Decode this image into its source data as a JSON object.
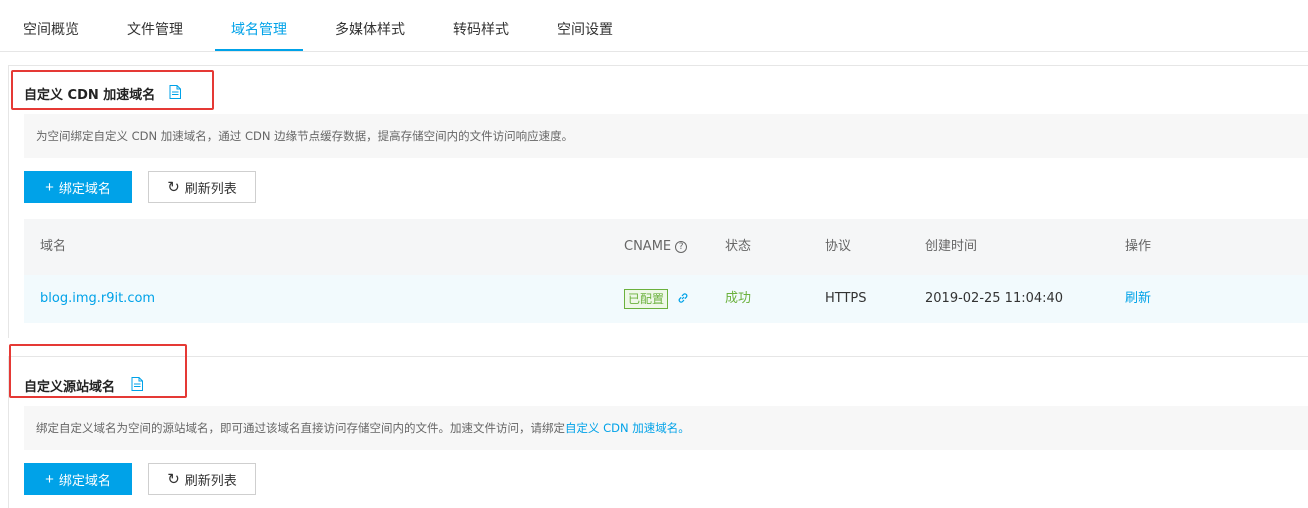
{
  "tabs": [
    {
      "label": "空间概览"
    },
    {
      "label": "文件管理"
    },
    {
      "label": "域名管理",
      "active": true
    },
    {
      "label": "多媒体样式"
    },
    {
      "label": "转码样式"
    },
    {
      "label": "空间设置"
    }
  ],
  "cdn_section": {
    "title": "自定义 CDN 加速域名",
    "description": "为空间绑定自定义 CDN 加速域名，通过 CDN 边缘节点缓存数据，提高存储空间内的文件访问响应速度。",
    "bind_button": "绑定域名",
    "refresh_button": "刷新列表",
    "table": {
      "headers": {
        "domain": "域名",
        "cname": "CNAME",
        "status": "状态",
        "protocol": "协议",
        "created": "创建时间",
        "action": "操作"
      },
      "rows": [
        {
          "domain": "blog.img.r9it.com",
          "cname_badge": "已配置",
          "status": "成功",
          "protocol": "HTTPS",
          "created": "2019-02-25 11:04:40",
          "action": "刷新"
        }
      ]
    }
  },
  "origin_section": {
    "title": "自定义源站域名",
    "description": "绑定自定义域名为空间的源站域名，即可通过该域名直接访问存储空间内的文件。加速文件访问，请绑定",
    "description_link": "自定义 CDN 加速域名。",
    "bind_button": "绑定域名",
    "refresh_button": "刷新列表"
  },
  "colors": {
    "accent": "#00a2e8",
    "success": "#6bb13d",
    "highlight": "#e53935"
  },
  "icons": [
    "document-icon",
    "plus-icon",
    "refresh-icon",
    "help-icon",
    "link-icon"
  ]
}
